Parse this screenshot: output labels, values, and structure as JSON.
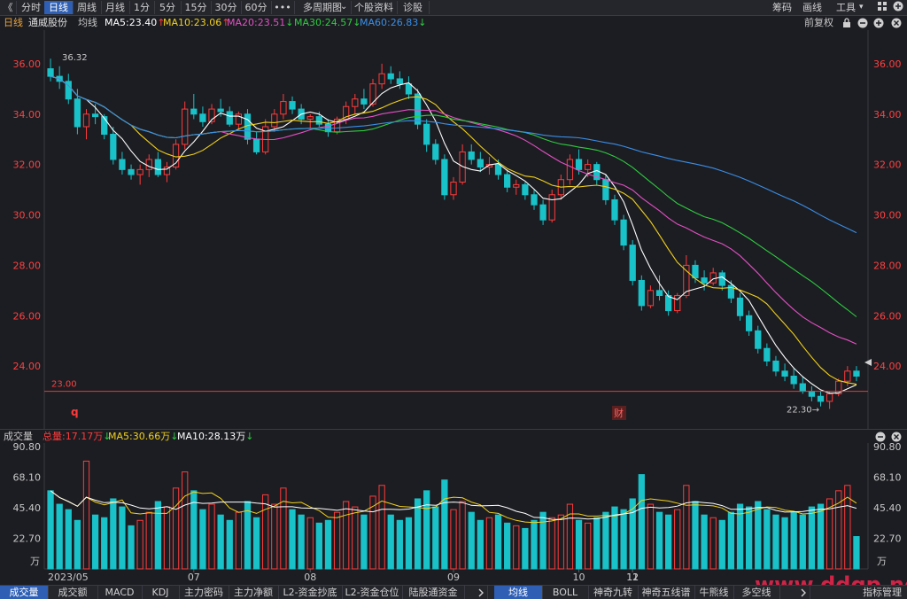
{
  "top_bar": {
    "back": "《",
    "tabs": [
      "分时",
      "日线",
      "周线",
      "月线",
      "1分",
      "5分",
      "15分",
      "30分",
      "60分",
      "•••",
      "多周期图",
      "个股资料",
      "诊股"
    ],
    "active_index": 1,
    "multi_arrow": "⌄",
    "right": {
      "chip": "筹码",
      "draw": "画线",
      "tools": "工具",
      "tools_arrow": "▾"
    }
  },
  "legend": {
    "period": "日线",
    "stock": "通威股份",
    "line_label": "均线",
    "ma5": "MA5:23.40",
    "ma10": "MA10:23.06",
    "ma20": "MA20:23.51",
    "ma30": "MA30:24.57",
    "ma60": "MA60:26.83",
    "adjust": "前复权",
    "arrow_up": "↑",
    "arrow_down": "↓"
  },
  "colors": {
    "up": "#ff3b3b",
    "down": "#19c2c9",
    "ma5": "#ffffff",
    "ma10": "#f2d11b",
    "ma20": "#e44fc4",
    "ma30": "#2ecc40",
    "ma60": "#3a8ee6",
    "axis_price": "#ff4040"
  },
  "price_axis": {
    "ticks": [
      "36.00",
      "34.00",
      "32.00",
      "30.00",
      "28.00",
      "26.00",
      "24.00"
    ]
  },
  "price_annotations": {
    "high": "36.32",
    "low": "22.30→",
    "ref_line": "23.00",
    "marker_q": "q",
    "marker_cai": "财"
  },
  "volume": {
    "title": "成交量",
    "total": "总量:17.17万",
    "ma5": "MA5:30.66万",
    "ma10": "MA10:28.13万",
    "ticks": [
      "90.80",
      "68.10",
      "45.40",
      "22.70"
    ],
    "unit": "万"
  },
  "x_axis": {
    "labels": [
      "2023/05",
      "07",
      "08",
      "09",
      "10",
      "11",
      "12"
    ]
  },
  "bottom_tabs": [
    "成交量",
    "成交额",
    "MACD",
    "KDJ",
    "主力密码",
    "主力净额",
    "L2-资金抄底",
    "L2-资金仓位",
    "陆股通资金"
  ],
  "bottom_tabs_right": [
    "均线",
    "BOLL",
    "神奇九转",
    "神奇五线谱",
    "牛熊线",
    "多空线"
  ],
  "bottom_more": "指标管理",
  "watermark": "www.ddgp.net",
  "chart_data": {
    "type": "candlestick",
    "ohlc": [
      [
        35.8,
        36.2,
        35.3,
        35.5
      ],
      [
        35.5,
        35.9,
        35.0,
        35.3
      ],
      [
        35.3,
        35.6,
        34.4,
        34.6
      ],
      [
        34.6,
        35.0,
        33.2,
        33.5
      ],
      [
        33.5,
        34.2,
        33.0,
        34.0
      ],
      [
        34.0,
        34.4,
        33.6,
        33.9
      ],
      [
        33.9,
        34.0,
        33.0,
        33.2
      ],
      [
        33.2,
        33.5,
        32.0,
        32.2
      ],
      [
        32.2,
        32.5,
        31.6,
        31.8
      ],
      [
        31.8,
        32.0,
        31.4,
        31.6
      ],
      [
        31.6,
        32.0,
        31.2,
        31.8
      ],
      [
        31.8,
        32.4,
        31.5,
        32.2
      ],
      [
        32.2,
        32.5,
        31.5,
        31.6
      ],
      [
        31.6,
        32.1,
        31.3,
        31.9
      ],
      [
        31.9,
        33.0,
        31.8,
        32.8
      ],
      [
        32.8,
        34.5,
        32.6,
        34.2
      ],
      [
        34.2,
        34.8,
        33.8,
        34.0
      ],
      [
        34.0,
        34.3,
        33.5,
        33.7
      ],
      [
        33.7,
        34.4,
        33.6,
        34.2
      ],
      [
        34.2,
        34.6,
        33.9,
        34.1
      ],
      [
        34.1,
        34.3,
        33.5,
        33.6
      ],
      [
        33.6,
        34.1,
        33.4,
        34.0
      ],
      [
        34.0,
        34.2,
        32.8,
        33.0
      ],
      [
        33.0,
        33.3,
        32.4,
        32.5
      ],
      [
        32.5,
        33.8,
        32.4,
        33.5
      ],
      [
        33.5,
        34.2,
        33.3,
        34.0
      ],
      [
        34.0,
        34.8,
        33.8,
        34.5
      ],
      [
        34.5,
        34.7,
        34.0,
        34.2
      ],
      [
        34.2,
        34.4,
        33.6,
        33.8
      ],
      [
        33.8,
        34.0,
        33.4,
        33.9
      ],
      [
        33.9,
        34.1,
        33.5,
        33.6
      ],
      [
        33.6,
        33.8,
        33.1,
        33.3
      ],
      [
        33.3,
        33.9,
        33.2,
        33.8
      ],
      [
        33.8,
        34.5,
        33.6,
        34.3
      ],
      [
        34.3,
        34.8,
        34.0,
        34.6
      ],
      [
        34.6,
        35.0,
        34.2,
        34.4
      ],
      [
        34.4,
        35.4,
        34.3,
        35.2
      ],
      [
        35.2,
        36.0,
        35.0,
        35.6
      ],
      [
        35.6,
        35.9,
        35.2,
        35.4
      ],
      [
        35.4,
        35.7,
        35.0,
        35.2
      ],
      [
        35.2,
        35.5,
        34.6,
        34.8
      ],
      [
        34.8,
        35.0,
        33.4,
        33.6
      ],
      [
        33.6,
        33.8,
        32.5,
        32.8
      ],
      [
        32.8,
        33.0,
        32.0,
        32.2
      ],
      [
        32.2,
        32.4,
        30.6,
        30.8
      ],
      [
        30.8,
        31.5,
        30.6,
        31.3
      ],
      [
        31.3,
        32.8,
        31.2,
        32.5
      ],
      [
        32.5,
        32.8,
        32.0,
        32.2
      ],
      [
        32.2,
        32.5,
        31.7,
        31.9
      ],
      [
        31.9,
        32.3,
        31.6,
        32.0
      ],
      [
        32.0,
        32.2,
        31.4,
        31.6
      ],
      [
        31.6,
        31.8,
        30.9,
        31.1
      ],
      [
        31.1,
        31.4,
        30.8,
        31.2
      ],
      [
        31.2,
        31.3,
        30.6,
        30.8
      ],
      [
        30.8,
        31.0,
        30.2,
        30.4
      ],
      [
        30.4,
        30.6,
        29.6,
        29.8
      ],
      [
        29.8,
        31.0,
        29.7,
        30.8
      ],
      [
        30.8,
        31.6,
        30.6,
        31.4
      ],
      [
        31.4,
        32.4,
        31.2,
        32.2
      ],
      [
        32.2,
        32.6,
        31.6,
        31.8
      ],
      [
        31.8,
        32.2,
        31.5,
        32.0
      ],
      [
        32.0,
        32.1,
        31.2,
        31.4
      ],
      [
        31.4,
        31.6,
        30.4,
        30.6
      ],
      [
        30.6,
        30.8,
        29.6,
        29.8
      ],
      [
        29.8,
        30.0,
        28.6,
        28.8
      ],
      [
        28.8,
        29.0,
        27.2,
        27.4
      ],
      [
        27.4,
        27.6,
        26.2,
        26.4
      ],
      [
        26.4,
        27.2,
        26.3,
        27.0
      ],
      [
        27.0,
        27.6,
        26.6,
        26.8
      ],
      [
        26.8,
        27.0,
        26.0,
        26.2
      ],
      [
        26.2,
        26.9,
        26.1,
        26.8
      ],
      [
        26.8,
        28.4,
        26.7,
        28.0
      ],
      [
        28.0,
        28.2,
        27.3,
        27.5
      ],
      [
        27.5,
        27.8,
        27.0,
        27.3
      ],
      [
        27.3,
        27.9,
        27.2,
        27.7
      ],
      [
        27.7,
        27.8,
        27.0,
        27.2
      ],
      [
        27.2,
        27.4,
        26.5,
        26.7
      ],
      [
        26.7,
        26.9,
        25.8,
        26.0
      ],
      [
        26.0,
        26.2,
        25.2,
        25.4
      ],
      [
        25.4,
        25.6,
        24.5,
        24.7
      ],
      [
        24.7,
        24.9,
        24.0,
        24.2
      ],
      [
        24.2,
        24.4,
        23.6,
        23.8
      ],
      [
        23.8,
        24.1,
        23.4,
        23.6
      ],
      [
        23.6,
        23.9,
        23.1,
        23.3
      ],
      [
        23.3,
        23.6,
        22.9,
        23.0
      ],
      [
        23.0,
        23.2,
        22.6,
        22.8
      ],
      [
        22.8,
        23.0,
        22.4,
        22.6
      ],
      [
        22.6,
        23.0,
        22.3,
        22.9
      ],
      [
        22.9,
        23.5,
        22.8,
        23.4
      ],
      [
        23.4,
        24.0,
        23.2,
        23.8
      ],
      [
        23.8,
        24.0,
        23.4,
        23.6
      ]
    ],
    "volume": [
      58,
      48,
      44,
      36,
      80,
      40,
      38,
      52,
      46,
      32,
      36,
      42,
      50,
      46,
      60,
      72,
      58,
      44,
      48,
      40,
      36,
      42,
      50,
      38,
      55,
      48,
      60,
      44,
      40,
      38,
      34,
      36,
      42,
      50,
      46,
      40,
      54,
      62,
      40,
      36,
      38,
      52,
      58,
      46,
      66,
      44,
      50,
      42,
      36,
      38,
      40,
      34,
      32,
      30,
      36,
      42,
      38,
      40,
      48,
      36,
      34,
      38,
      42,
      46,
      44,
      52,
      70,
      48,
      42,
      40,
      44,
      62,
      50,
      40,
      38,
      36,
      42,
      48,
      46,
      50,
      44,
      40,
      38,
      42,
      40,
      46,
      48,
      52,
      58,
      62,
      24
    ],
    "price_range": [
      22.0,
      36.7
    ],
    "volume_range": [
      0,
      90.8
    ]
  }
}
